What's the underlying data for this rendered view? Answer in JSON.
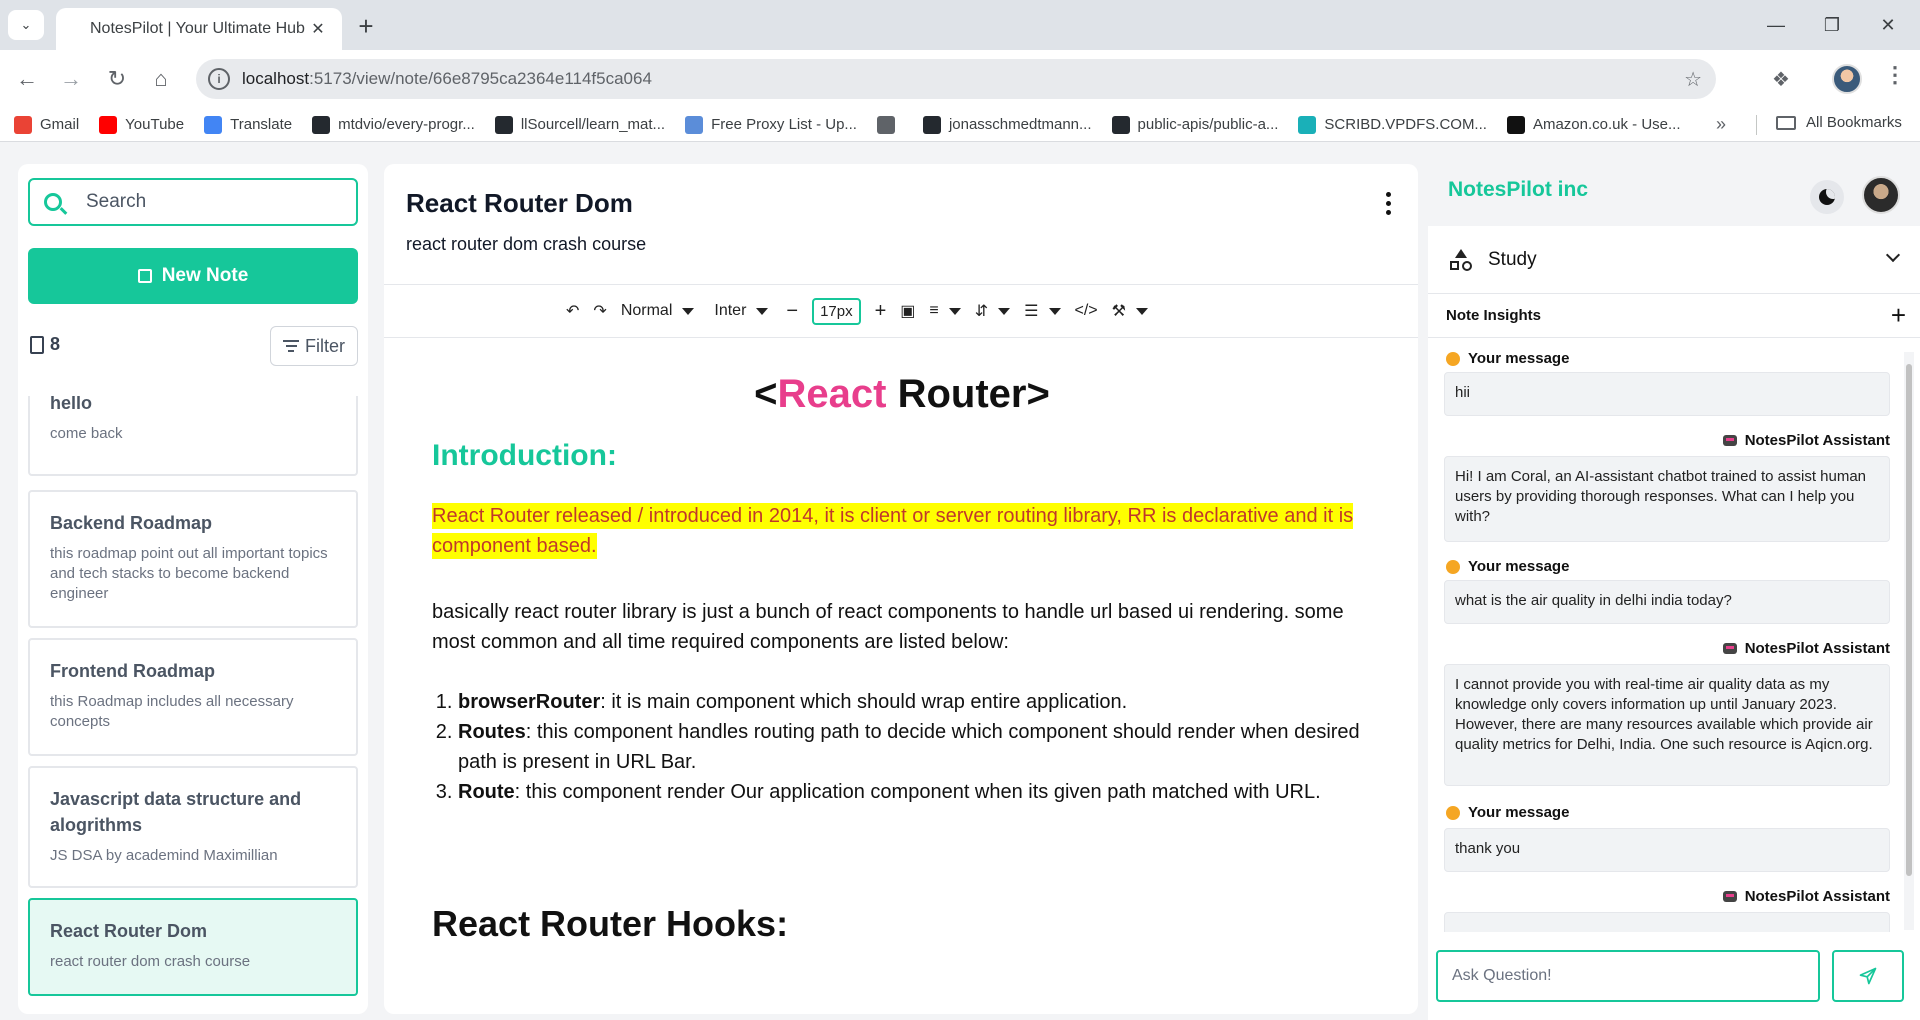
{
  "browser": {
    "tab_title": "NotesPilot | Your Ultimate Hub",
    "url_host": "localhost",
    "url_path": ":5173/view/note/66e8795ca2364e114f5ca064",
    "bookmarks": [
      {
        "label": "Gmail",
        "icon": "gmail-icon",
        "color": "#ea4335"
      },
      {
        "label": "YouTube",
        "icon": "youtube-icon",
        "color": "#ff0000"
      },
      {
        "label": "Translate",
        "icon": "translate-icon",
        "color": "#4285f4"
      },
      {
        "label": "mtdvio/every-progr...",
        "icon": "github-icon",
        "color": "#24292f"
      },
      {
        "label": "llSourcell/learn_mat...",
        "icon": "github-icon",
        "color": "#24292f"
      },
      {
        "label": "Free Proxy List - Up...",
        "icon": "proxy-list-icon",
        "color": "#5b8dd9"
      },
      {
        "label": "",
        "icon": "globe-icon",
        "color": "#5f6368"
      },
      {
        "label": "jonasschmedtmann...",
        "icon": "github-icon",
        "color": "#24292f"
      },
      {
        "label": "public-apis/public-a...",
        "icon": "github-icon",
        "color": "#24292f"
      },
      {
        "label": "SCRIBD.VPDFS.COM...",
        "icon": "scribd-icon",
        "color": "#1ab0b8"
      },
      {
        "label": "Amazon.co.uk - Use...",
        "icon": "amazon-icon",
        "color": "#111111"
      }
    ],
    "all_bookmarks": "All Bookmarks"
  },
  "sidebar": {
    "search_placeholder": "Search",
    "new_note": "New Note",
    "count": "8",
    "filter": "Filter",
    "notes": [
      {
        "title": "hello",
        "desc": "come back"
      },
      {
        "title": "Backend Roadmap",
        "desc": "this roadmap point out all important topics and tech stacks to become backend engineer"
      },
      {
        "title": "Frontend Roadmap",
        "desc": "this Roadmap includes all necessary concepts"
      },
      {
        "title": "Javascript data structure and alogrithms",
        "desc": "JS DSA by academind Maximillian"
      },
      {
        "title": "React Router Dom",
        "desc": "react router dom crash course"
      }
    ]
  },
  "editor": {
    "title": "React Router Dom",
    "subtitle": "react router dom crash course",
    "toolbar": {
      "block_type": "Normal",
      "font": "Inter",
      "font_size": "17px"
    },
    "content": {
      "heading_open": "<",
      "heading_react": "React",
      "heading_rest": " Router>",
      "intro": "Introduction:",
      "highlight": "React Router released / introduced in 2014, it is client or server routing library, RR is declarative and it is component based.",
      "para": "basically react router library is just a bunch of react components to handle url based ui rendering. some most common and all time required components are listed below:",
      "list": [
        {
          "term": "browserRouter",
          "text": ": it is main component which should wrap entire application."
        },
        {
          "term": "Routes",
          "text": ": this component handles routing path to decide which component should render when desired path is present in URL Bar."
        },
        {
          "term": "Route",
          "text": ": this component render Our application component when its given path matched with URL."
        }
      ],
      "hooks_heading": "React Router Hooks:"
    },
    "colors": {
      "accent": "#16c79a",
      "pink": "#e83e8c",
      "highlight_bg": "#ffff00",
      "highlight_text": "#c0392b"
    }
  },
  "right": {
    "brand": "NotesPilot inc",
    "study": "Study",
    "insights": "Note Insights",
    "user_label": "Your message",
    "bot_label": "NotesPilot Assistant",
    "messages": [
      {
        "role": "user",
        "text": "hii"
      },
      {
        "role": "bot",
        "text": "Hi! I am Coral, an AI-assistant chatbot trained to assist human users by providing thorough responses. What can I help you with?"
      },
      {
        "role": "user",
        "text": "what is the air quality in delhi india today?"
      },
      {
        "role": "bot",
        "text": "I cannot provide you with real-time air quality data as my knowledge only covers information up until January 2023. However, there are many resources available which provide air quality metrics for Delhi, India. One such resource is Aqicn.org."
      },
      {
        "role": "user",
        "text": "thank you"
      },
      {
        "role": "bot",
        "text": ""
      }
    ],
    "ask_placeholder": "Ask Question!"
  }
}
